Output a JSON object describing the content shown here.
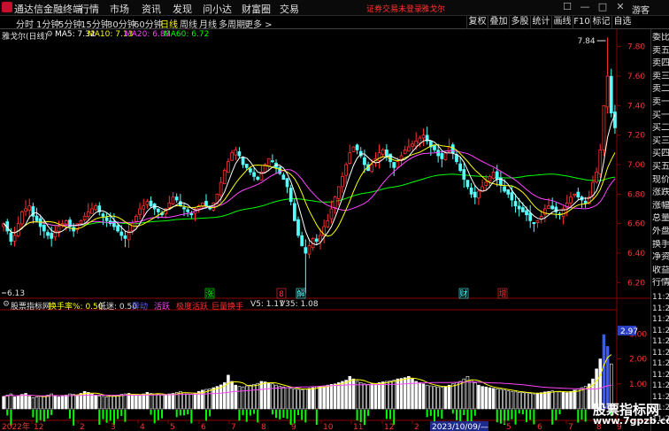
{
  "app": {
    "title": "通达信金融终端"
  },
  "menu": [
    "行情",
    "市场",
    "资讯",
    "发现",
    "问小达",
    "财富圈",
    "交易"
  ],
  "notice": "证券交易未登录",
  "stock_name": "雅戈尔",
  "window_buttons": [
    "☐",
    "—",
    "□",
    "✕"
  ],
  "guest": "游客",
  "period_tabs": [
    "分时",
    "1分钟",
    "5分钟",
    "15分钟",
    "30分钟",
    "60分钟",
    "日线",
    "周线",
    "月线",
    "多周期",
    "更多 >"
  ],
  "active_period": "日线",
  "right_toolbar": [
    "复权",
    "叠加",
    "多股",
    "统计",
    "画线",
    "F10",
    "标记",
    "自选"
  ],
  "legend": {
    "name": "雅戈尔(日线)",
    "ma5": "MA5: 7.32",
    "ma10": "MA10: 7.13",
    "ma20": "MA20: 6.89",
    "ma60": "MA60: 6.72"
  },
  "colors": {
    "up": "#ff3232",
    "down": "#54ffff",
    "ma5": "#ffffff",
    "ma10": "#ffff00",
    "ma20": "#ff44ff",
    "ma60": "#00ff00",
    "bg": "#000000"
  },
  "y_axis": {
    "ticks": [
      "7.80",
      "7.60",
      "7.40",
      "7.20",
      "7.00",
      "6.80",
      "6.60",
      "6.40",
      "6.20"
    ]
  },
  "max_label": "7.84",
  "min_label": "6.13",
  "signals": [
    "涨",
    "8",
    "解",
    "财",
    "增"
  ],
  "indicator": {
    "name": "股票指标网",
    "p1": "换手率%: 0.50",
    "p2": "低迷: 0.50",
    "p3": "异动",
    "p4": "活跃",
    "p5": "极度活跃",
    "p6": "巨量换手",
    "p7": "V5: 1.17",
    "p8": "V35: 1.08",
    "current_value": "2.97",
    "y_ticks": [
      "3.00",
      "2.00",
      "1.00"
    ]
  },
  "x_axis": {
    "year_label": "2022年",
    "ticks": [
      "12",
      "2",
      "3",
      "4",
      "5",
      "6",
      "7",
      "8",
      "9",
      "10",
      "11",
      "12",
      "2",
      "3",
      "4",
      "5",
      "6",
      "7",
      "8",
      "9"
    ],
    "cursor_date": "2023/10/09/—"
  },
  "side_panel": {
    "labels": [
      "委比",
      "卖五",
      "卖四",
      "卖三",
      "卖二",
      "卖一",
      "买一",
      "买二",
      "买三",
      "买四",
      "买五",
      "现价",
      "涨跌",
      "涨幅",
      "总量",
      "外盘",
      "换手",
      "净资",
      "收益",
      "行情"
    ],
    "times": [
      "11:29",
      "11:29",
      "11:29",
      "11:29",
      "11:29",
      "11:29",
      "11:29",
      "11:29",
      "11:29",
      "11:29",
      "11:29",
      "11:29"
    ]
  },
  "watermark": {
    "cn": "股票指标网",
    "url": "www.7gpzb.com"
  },
  "chart_data": {
    "type": "candlestick",
    "note_ylim": [
      6.1,
      7.9
    ],
    "ylim": [
      6.1,
      7.9
    ],
    "series": [
      {
        "name": "MA5"
      },
      {
        "name": "MA10"
      },
      {
        "name": "MA20"
      },
      {
        "name": "MA60"
      }
    ],
    "close": [
      6.6,
      6.55,
      6.48,
      6.52,
      6.6,
      6.68,
      6.7,
      6.72,
      6.65,
      6.62,
      6.58,
      6.55,
      6.52,
      6.5,
      6.55,
      6.58,
      6.6,
      6.62,
      6.58,
      6.55,
      6.6,
      6.62,
      6.65,
      6.68,
      6.7,
      6.72,
      6.68,
      6.65,
      6.62,
      6.6,
      6.58,
      6.55,
      6.52,
      6.5,
      6.55,
      6.6,
      6.65,
      6.7,
      6.72,
      6.75,
      6.72,
      6.7,
      6.68,
      6.66,
      6.7,
      6.74,
      6.78,
      6.76,
      6.72,
      6.7,
      6.68,
      6.66,
      6.7,
      6.72,
      6.74,
      6.72,
      6.7,
      6.74,
      6.8,
      6.88,
      6.96,
      7.02,
      7.08,
      7.1,
      7.06,
      7.0,
      6.98,
      6.95,
      6.92,
      6.9,
      6.95,
      7.0,
      7.04,
      7.02,
      6.98,
      6.94,
      6.9,
      6.85,
      6.75,
      6.62,
      6.52,
      6.45,
      6.4,
      6.45,
      6.5,
      6.48,
      6.52,
      6.58,
      6.62,
      6.7,
      6.78,
      6.85,
      6.92,
      7.0,
      7.08,
      7.12,
      7.1,
      7.06,
      7.0,
      6.96,
      7.0,
      7.04,
      7.08,
      7.1,
      7.06,
      7.02,
      6.98,
      7.02,
      7.06,
      7.1,
      7.12,
      7.14,
      7.16,
      7.18,
      7.2,
      7.16,
      7.12,
      7.1,
      7.06,
      7.04,
      7.08,
      7.12,
      7.08,
      7.02,
      6.96,
      6.9,
      6.85,
      6.8,
      6.78,
      6.82,
      6.85,
      6.88,
      6.92,
      6.95,
      6.9,
      6.86,
      6.82,
      6.8,
      6.76,
      6.72,
      6.7,
      6.68,
      6.66,
      6.62,
      6.6,
      6.62,
      6.65,
      6.7,
      6.72,
      6.7,
      6.68,
      6.66,
      6.7,
      6.74,
      6.78,
      6.8,
      6.78,
      6.76,
      6.74,
      6.78,
      6.88,
      6.95,
      7.1,
      7.4,
      7.6,
      7.35,
      7.25
    ],
    "turnover": [
      0.5,
      0.55,
      0.6,
      0.48,
      0.52,
      0.58,
      0.62,
      0.5,
      0.45,
      0.48,
      0.5,
      0.52,
      0.55,
      0.6,
      0.5,
      0.48,
      0.52,
      0.55,
      0.6,
      0.58,
      0.56,
      0.62,
      0.7,
      0.66,
      0.6,
      0.55,
      0.52,
      0.5,
      0.48,
      0.5,
      0.52,
      0.55,
      0.58,
      0.6,
      0.62,
      0.58,
      0.55,
      0.52,
      0.6,
      0.66,
      0.62,
      0.6,
      0.58,
      0.55,
      0.56,
      0.6,
      0.62,
      0.66,
      0.7,
      0.65,
      0.6,
      0.58,
      0.62,
      0.7,
      0.75,
      0.78,
      0.8,
      0.85,
      0.9,
      0.96,
      1.05,
      1.35,
      1.1,
      0.95,
      0.9,
      0.88,
      0.92,
      0.95,
      0.98,
      1.02,
      1.1,
      1.08,
      1.05,
      1.0,
      0.95,
      0.9,
      0.88,
      0.85,
      0.82,
      0.8,
      0.78,
      0.76,
      0.8,
      0.82,
      0.85,
      0.88,
      0.9,
      0.92,
      0.95,
      0.98,
      1.0,
      1.05,
      1.1,
      1.15,
      1.3,
      1.2,
      1.1,
      1.05,
      1.0,
      0.98,
      1.0,
      1.02,
      1.05,
      1.08,
      1.1,
      1.12,
      1.15,
      1.2,
      1.22,
      1.25,
      1.3,
      1.2,
      1.1,
      1.05,
      1.0,
      0.95,
      0.92,
      0.9,
      0.88,
      0.86,
      0.9,
      0.95,
      1.0,
      1.05,
      1.1,
      1.2,
      1.3,
      1.15,
      1.05,
      0.95,
      0.9,
      0.88,
      0.85,
      0.82,
      0.8,
      0.78,
      0.75,
      0.72,
      0.7,
      0.68,
      0.66,
      0.65,
      0.64,
      0.62,
      0.6,
      0.62,
      0.65,
      0.68,
      0.7,
      0.72,
      0.7,
      0.68,
      0.66,
      0.65,
      0.7,
      0.75,
      0.8,
      0.85,
      0.9,
      1.0,
      1.2,
      1.6,
      2.0,
      2.97,
      2.5,
      1.8
    ]
  }
}
